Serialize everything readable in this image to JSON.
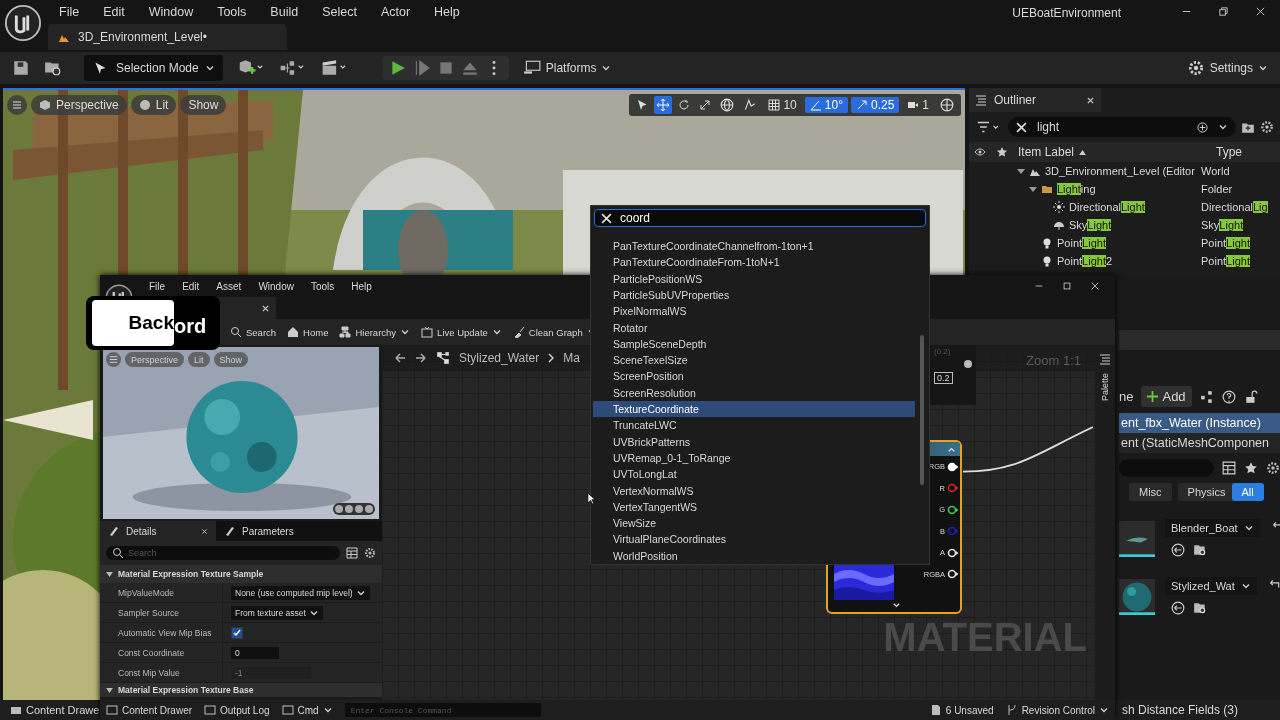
{
  "app": {
    "title": "UEBoatEnvironment",
    "menu": [
      "File",
      "Edit",
      "Window",
      "Tools",
      "Build",
      "Select",
      "Actor",
      "Help"
    ],
    "level_tab": "3D_Environment_Level•"
  },
  "toolbar": {
    "mode": "Selection Mode",
    "platforms": "Platforms",
    "settings": "Settings"
  },
  "viewport": {
    "view_buttons": [
      "Perspective",
      "Lit",
      "Show"
    ],
    "tools": [
      {
        "kind": "select",
        "selected": false
      },
      {
        "kind": "move",
        "selected": true
      },
      {
        "kind": "rotate",
        "selected": false
      },
      {
        "kind": "scale",
        "selected": false
      }
    ],
    "snaps": [
      {
        "kind": "grid",
        "value": "10",
        "on": false
      },
      {
        "kind": "angle",
        "value": "10°",
        "on": true
      },
      {
        "kind": "scale",
        "value": "0.25",
        "on": true
      },
      {
        "kind": "camera",
        "value": "1",
        "on": false
      }
    ]
  },
  "outliner": {
    "title": "Outliner",
    "search": "light",
    "columns": [
      "Item Label",
      "Type"
    ],
    "rows": [
      {
        "kind": "world",
        "label": [
          {
            "text": "3D_Environment_Level (Editor",
            "match": false
          }
        ],
        "type": [
          {
            "text": "World",
            "match": false
          }
        ],
        "expanded": true,
        "children": [
          {
            "kind": "folder",
            "label": [
              {
                "text": "Light",
                "match": true
              },
              {
                "text": "ing",
                "match": false
              }
            ],
            "type": [
              {
                "text": "Folder",
                "match": false
              }
            ],
            "expanded": true,
            "children": [
              {
                "kind": "directional",
                "label": [
                  {
                    "text": "Directional",
                    "match": false
                  },
                  {
                    "text": "Light",
                    "match": true
                  }
                ],
                "type": [
                  {
                    "text": "Directional",
                    "match": false
                  },
                  {
                    "text": "Lig",
                    "match": true
                  }
                ]
              },
              {
                "kind": "sky",
                "label": [
                  {
                    "text": "Sky",
                    "match": false
                  },
                  {
                    "text": "Light",
                    "match": true
                  }
                ],
                "type": [
                  {
                    "text": "Sky",
                    "match": false
                  },
                  {
                    "text": "Light",
                    "match": true
                  }
                ]
              }
            ]
          },
          {
            "kind": "point",
            "label": [
              {
                "text": "Point",
                "match": false
              },
              {
                "text": "Light",
                "match": true
              }
            ],
            "type": [
              {
                "text": "Point",
                "match": false
              },
              {
                "text": "Light",
                "match": true
              }
            ]
          },
          {
            "kind": "point",
            "label": [
              {
                "text": "Point",
                "match": false
              },
              {
                "text": "Light",
                "match": true
              },
              {
                "text": "2",
                "match": false
              }
            ],
            "type": [
              {
                "text": "Point",
                "match": false
              },
              {
                "text": "Light",
                "match": true
              }
            ]
          }
        ]
      }
    ]
  },
  "level_details": {
    "header": "ne",
    "add": "Add",
    "components": [
      {
        "label": "ent_fbx_Water (Instance)",
        "selected": true
      },
      {
        "label": "ent (StaticMeshComponen",
        "selected": false
      }
    ],
    "filters": [
      {
        "label": "Misc",
        "selected": false
      },
      {
        "label": "Physics",
        "selected": false
      },
      {
        "label": "All",
        "selected": true
      }
    ],
    "assets": [
      {
        "value": "Blender_Boat"
      },
      {
        "value": "Stylized_Wat"
      }
    ]
  },
  "material_editor": {
    "menu": [
      "File",
      "Edit",
      "Asset",
      "Window",
      "Tools",
      "Help"
    ],
    "toolbar": [
      {
        "kind": "search",
        "label": "Search",
        "dropdown": false
      },
      {
        "kind": "home",
        "label": "Home",
        "dropdown": false
      },
      {
        "kind": "hierarchy",
        "label": "Hierarchy",
        "dropdown": true
      },
      {
        "kind": "live",
        "label": "Live Update",
        "dropdown": true
      },
      {
        "kind": "clean",
        "label": "Clean Graph",
        "dropdown": true
      }
    ],
    "preview": {
      "view_buttons": [
        "Perspective",
        "Lit",
        "Show"
      ]
    },
    "details": {
      "tabs": [
        {
          "label": "Details",
          "selected": true
        },
        {
          "label": "Parameters",
          "selected": false
        }
      ],
      "search_placeholder": "Search",
      "section": "Material Expression Texture Sample",
      "properties": [
        {
          "kind": "dropdown",
          "label": "MipValueMode",
          "value": "None (use computed mip level)"
        },
        {
          "kind": "dropdown",
          "label": "Sampler Source",
          "value": "From texture asset"
        },
        {
          "kind": "checkbox",
          "label": "Automatic View Mip Bias",
          "checked": true
        },
        {
          "kind": "number",
          "label": "Const Coordinate",
          "value": "0",
          "disabled": false
        },
        {
          "kind": "number",
          "label": "Const Mip Value",
          "value": "-1",
          "disabled": true
        }
      ],
      "next_section": "Material Expression Texture Base"
    },
    "graph": {
      "breadcrumb": [
        "Stylized_Water",
        "Ma"
      ],
      "zoom": "Zoom 1:1",
      "watermark": "MATERIAL",
      "palette": "Palette",
      "param_node": {
        "hint": "(0.2)",
        "value": "0.2"
      },
      "pins": [
        {
          "label": "RGB",
          "color": "#ffffff",
          "connected": true
        },
        {
          "label": "R",
          "color": "#d02a2a",
          "connected": false
        },
        {
          "label": "G",
          "color": "#3ecf3e",
          "connected": false
        },
        {
          "label": "B",
          "color": "#2020c0",
          "connected": false
        },
        {
          "label": "A",
          "color": "#e0e0e0",
          "connected": false
        },
        {
          "label": "RGBA",
          "color": "#e0e0e0",
          "connected": false
        }
      ]
    },
    "status": {
      "buttons": [
        "Content Drawer",
        "Output Log",
        "Cmd"
      ],
      "console_placeholder": "Enter Console Command",
      "unsaved": "6 Unsaved",
      "revision": "Revision Control"
    }
  },
  "search_popup": {
    "query": "coord",
    "items": [
      {
        "label": "PanTextureCoordinateChannelfrom-1ton+1",
        "selected": false
      },
      {
        "label": "PanTextureCoordinateFrom-1toN+1",
        "selected": false
      },
      {
        "label": "ParticlePositionWS",
        "selected": false
      },
      {
        "label": "ParticleSubUVProperties",
        "selected": false
      },
      {
        "label": "PixelNormalWS",
        "selected": false
      },
      {
        "label": "Rotator",
        "selected": false
      },
      {
        "label": "SampleSceneDepth",
        "selected": false
      },
      {
        "label": "SceneTexelSize",
        "selected": false
      },
      {
        "label": "ScreenPosition",
        "selected": false
      },
      {
        "label": "ScreenResolution",
        "selected": false
      },
      {
        "label": "TextureCoordinate",
        "selected": true
      },
      {
        "label": "TruncateLWC",
        "selected": false
      },
      {
        "label": "UVBrickPatterns",
        "selected": false
      },
      {
        "label": "UVRemap_0-1_ToRange",
        "selected": false
      },
      {
        "label": "UVToLongLat",
        "selected": false
      },
      {
        "label": "VertexNormalWS",
        "selected": false
      },
      {
        "label": "VertexTangentWS",
        "selected": false
      },
      {
        "label": "ViewSize",
        "selected": false
      },
      {
        "label": "VirtualPlaneCoordinates",
        "selected": false
      },
      {
        "label": "WorldPosition",
        "selected": false
      }
    ]
  },
  "key_overlay": {
    "key": "Back",
    "text": "ord"
  },
  "main_status": {
    "content_drawer": "Content Drawe",
    "distance_fields": "sh Distance Fields (3)"
  }
}
